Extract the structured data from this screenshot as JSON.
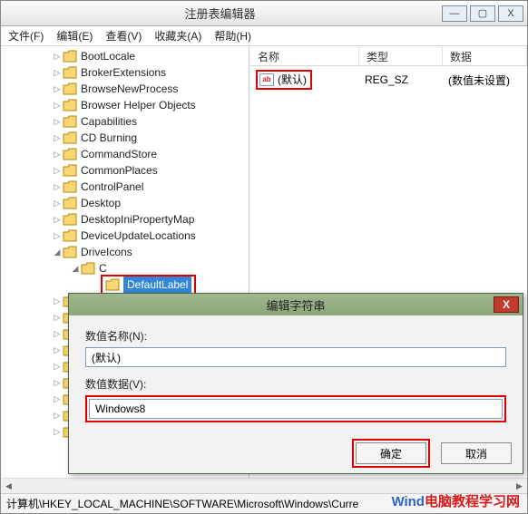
{
  "window": {
    "title": "注册表编辑器",
    "buttons": {
      "min": "—",
      "max": "▢",
      "close": "X"
    }
  },
  "menu": {
    "file": "文件(F)",
    "edit": "编辑(E)",
    "view": "查看(V)",
    "fav": "收藏夹(A)",
    "help": "帮助(H)"
  },
  "tree": {
    "items": [
      "BootLocale",
      "BrokerExtensions",
      "BrowseNewProcess",
      "Browser Helper Objects",
      "Capabilities",
      "CD Burning",
      "CommandStore",
      "CommonPlaces",
      "ControlPanel",
      "Desktop",
      "DesktopIniPropertyMap",
      "DeviceUpdateLocations"
    ],
    "driveicons": "DriveIcons",
    "c": "C",
    "defaultlabel": "DefaultLabel"
  },
  "list": {
    "headers": {
      "name": "名称",
      "type": "类型",
      "data": "数据"
    },
    "row": {
      "icon": "ab",
      "name": "(默认)",
      "type": "REG_SZ",
      "data": "(数值未设置)"
    }
  },
  "dialog": {
    "title": "编辑字符串",
    "name_label": "数值名称(N):",
    "name_value": "(默认)",
    "data_label": "数值数据(V):",
    "data_value": "Windows8",
    "ok": "确定",
    "cancel": "取消"
  },
  "statusbar": "计算机\\HKEY_LOCAL_MACHINE\\SOFTWARE\\Microsoft\\Windows\\Curre",
  "watermark": {
    "a": "Wind",
    "b": "电脑教程学习网"
  }
}
